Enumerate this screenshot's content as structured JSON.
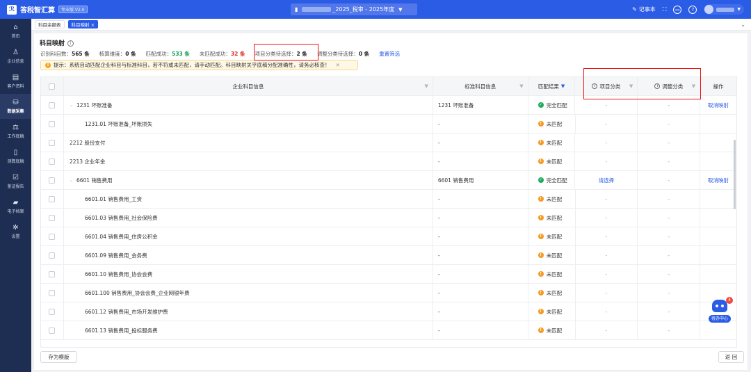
{
  "app": {
    "logo_text": "答税智汇算",
    "version": "专业版 V2.0"
  },
  "doc": {
    "title_suffix": "_2025_税审 - 2025年度"
  },
  "topbar": {
    "notes_label": "记事本"
  },
  "sidebar": {
    "items": [
      {
        "label": "首页",
        "icon": "⌂"
      },
      {
        "label": "企业信息",
        "icon": "♙"
      },
      {
        "label": "客户资料",
        "icon": "▤"
      },
      {
        "label": "数据采集",
        "icon": "⛁"
      },
      {
        "label": "工作底稿",
        "icon": "⚖"
      },
      {
        "label": "测算底稿",
        "icon": "▯"
      },
      {
        "label": "鉴证报告",
        "icon": "☑"
      },
      {
        "label": "电子档案",
        "icon": "▰"
      },
      {
        "label": "设置",
        "icon": "✲"
      }
    ]
  },
  "tabs": [
    {
      "label": "科目余额表"
    },
    {
      "label": "科目映射 ×"
    }
  ],
  "page": {
    "title": "科目映射"
  },
  "stats": {
    "recognized_label": "识别科目数：",
    "recognized_value": "565 条",
    "dimension_label": "核算维度：",
    "dimension_value": "0 条",
    "matched_label": "匹配成功：",
    "matched_value": "533 条",
    "unmatched_label": "未匹配成功：",
    "unmatched_value": "32 条",
    "project_pending_label": "项目分类待选择：",
    "project_pending_value": "2 条",
    "adjust_pending_label": "调整分类待选择：",
    "adjust_pending_value": "0 条",
    "reset_label": "重置筛选"
  },
  "tip": {
    "text": "提示：系统自动匹配企业科目与标准科目，若不符或未匹配，请手动匹配。科目映射关乎底稿分配准确性，请务必核查！"
  },
  "table": {
    "headers": {
      "enterprise": "企业科目信息",
      "standard": "标准科目信息",
      "match": "匹配结果",
      "project": "项目分类",
      "adjust": "调整分类",
      "ops": "操作"
    },
    "rows": [
      {
        "name": "1231 坏账准备",
        "level": 1,
        "standard": "1231 坏账准备",
        "status": "完全匹配",
        "ok": true,
        "project": "-",
        "adjust": "-",
        "op": "取消映射"
      },
      {
        "name": "1231.01 坏账准备_坏账损失",
        "level": 2,
        "standard": "-",
        "status": "未匹配",
        "ok": false,
        "project": "-",
        "adjust": "-",
        "op": ""
      },
      {
        "name": "2212 股份支付",
        "level": 0,
        "standard": "-",
        "status": "未匹配",
        "ok": false,
        "project": "-",
        "adjust": "-",
        "op": ""
      },
      {
        "name": "2213 企业年金",
        "level": 0,
        "standard": "-",
        "status": "未匹配",
        "ok": false,
        "project": "-",
        "adjust": "-",
        "op": ""
      },
      {
        "name": "6601 销售费用",
        "level": 1,
        "standard": "6601 销售费用",
        "status": "完全匹配",
        "ok": true,
        "project": "请选择",
        "adjust": "-",
        "op": "取消映射"
      },
      {
        "name": "6601.01 销售费用_工资",
        "level": 2,
        "standard": "-",
        "status": "未匹配",
        "ok": false,
        "project": "-",
        "adjust": "-",
        "op": ""
      },
      {
        "name": "6601.03 销售费用_社会保险费",
        "level": 2,
        "standard": "-",
        "status": "未匹配",
        "ok": false,
        "project": "-",
        "adjust": "-",
        "op": ""
      },
      {
        "name": "6601.04 销售费用_住房公积金",
        "level": 2,
        "standard": "-",
        "status": "未匹配",
        "ok": false,
        "project": "-",
        "adjust": "-",
        "op": ""
      },
      {
        "name": "6601.09 销售费用_会务费",
        "level": 2,
        "standard": "-",
        "status": "未匹配",
        "ok": false,
        "project": "-",
        "adjust": "-",
        "op": ""
      },
      {
        "name": "6601.10 销售费用_协会会费",
        "level": 2,
        "standard": "-",
        "status": "未匹配",
        "ok": false,
        "project": "-",
        "adjust": "-",
        "op": ""
      },
      {
        "name": "6601.100 销售费用_协会会费_企业网银年费",
        "level": 2,
        "standard": "-",
        "status": "未匹配",
        "ok": false,
        "project": "-",
        "adjust": "-",
        "op": ""
      },
      {
        "name": "6601.12 销售费用_市场开发维护费",
        "level": 2,
        "standard": "-",
        "status": "未匹配",
        "ok": false,
        "project": "-",
        "adjust": "-",
        "op": ""
      },
      {
        "name": "6601.13 销售费用_投标服务费",
        "level": 2,
        "standard": "-",
        "status": "未匹配",
        "ok": false,
        "project": "-",
        "adjust": "-",
        "op": ""
      }
    ]
  },
  "footer": {
    "save_template": "存为模版",
    "back": "返 回"
  },
  "assistant": {
    "label": "待办中心",
    "badge": "4"
  }
}
